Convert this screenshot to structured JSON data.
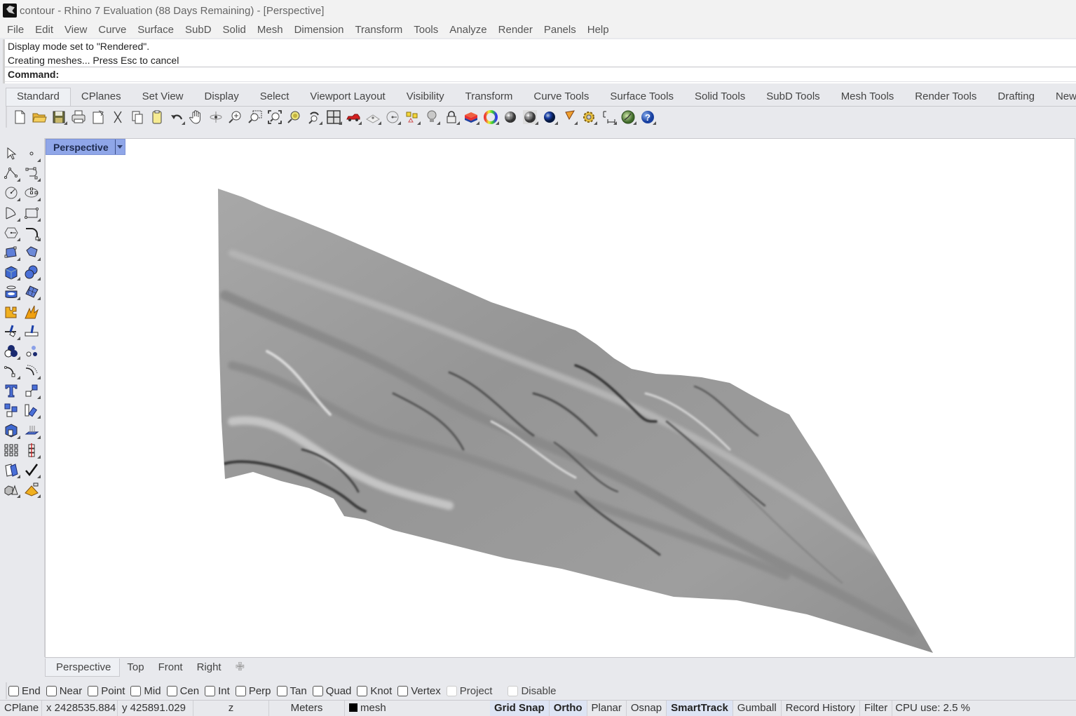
{
  "window": {
    "title": "contour - Rhino 7 Evaluation (88 Days Remaining) - [Perspective]",
    "app_icon": "rhino-icon"
  },
  "menubar": {
    "items": [
      "File",
      "Edit",
      "View",
      "Curve",
      "Surface",
      "SubD",
      "Solid",
      "Mesh",
      "Dimension",
      "Transform",
      "Tools",
      "Analyze",
      "Render",
      "Panels",
      "Help"
    ]
  },
  "command_history": {
    "lines": [
      "Display mode set to \"Rendered\".",
      "Creating meshes... Press Esc to cancel"
    ],
    "prompt_label": "Command:",
    "input_value": ""
  },
  "toolbar_tabs": {
    "active": "Standard",
    "items": [
      "Standard",
      "CPlanes",
      "Set View",
      "Display",
      "Select",
      "Viewport Layout",
      "Visibility",
      "Transform",
      "Curve Tools",
      "Surface Tools",
      "Solid Tools",
      "SubD Tools",
      "Mesh Tools",
      "Render Tools",
      "Drafting",
      "New in"
    ]
  },
  "standard_toolbar": {
    "icons": [
      "new-file-icon",
      "open-folder-icon",
      "save-icon",
      "print-icon",
      "import-icon",
      "cut-icon",
      "copy-icon",
      "paste-icon",
      "undo-icon",
      "pan-hand-icon",
      "rotate-view-icon",
      "zoom-dynamic-icon",
      "zoom-window-icon",
      "zoom-extents-icon",
      "zoom-selected-icon",
      "undo-view-icon",
      "four-viewports-icon",
      "car-named-views-icon",
      "cplane-icon",
      "circle-tool-icon",
      "select-points-icon",
      "light-bulb-icon",
      "lock-icon",
      "layer-icon",
      "color-wheel-icon",
      "shaded-sphere-icon",
      "rendered-sphere-icon",
      "material-sphere-icon",
      "render-cone-icon",
      "options-gear-icon",
      "dimension-icon",
      "globe-icon",
      "help-icon"
    ]
  },
  "sidebar": {
    "icons": [
      "select-arrow-icon",
      "point-icon",
      "polyline-icon",
      "curve-control-points-icon",
      "circle-icon",
      "ellipse-icon",
      "arc-icon",
      "rectangle-icon",
      "polygon-icon",
      "fillet-curve-icon",
      "surface-from-points-icon",
      "extrude-surface-icon",
      "box-solid-icon",
      "boolean-union-icon",
      "cylinder-icon",
      "mesh-surface-icon",
      "puzzle-icon",
      "explode-icon",
      "trim-icon",
      "split-icon",
      "boolean-icon",
      "group-icon",
      "curve-end-icon",
      "offset-curve-icon",
      "text-icon",
      "scale-icon",
      "array-icon",
      "align-icon",
      "block-icon",
      "contour-icon",
      "grid-array-icon",
      "section-icon",
      "analyze-icon",
      "check-icon",
      "solid-primitives-icon",
      "render-pyramid-icon"
    ]
  },
  "viewport": {
    "name": "Perspective",
    "display_mode": "Rendered",
    "background": "#ffffff",
    "mesh_color": "#9a9a9a"
  },
  "viewport_tabs": {
    "active": "Perspective",
    "items": [
      "Perspective",
      "Top",
      "Front",
      "Right"
    ],
    "add_icon": "plus-icon"
  },
  "osnaps": [
    {
      "label": "End",
      "checked": false,
      "enabled": true
    },
    {
      "label": "Near",
      "checked": false,
      "enabled": true
    },
    {
      "label": "Point",
      "checked": false,
      "enabled": true
    },
    {
      "label": "Mid",
      "checked": false,
      "enabled": true
    },
    {
      "label": "Cen",
      "checked": false,
      "enabled": true
    },
    {
      "label": "Int",
      "checked": false,
      "enabled": true
    },
    {
      "label": "Perp",
      "checked": false,
      "enabled": true
    },
    {
      "label": "Tan",
      "checked": false,
      "enabled": true
    },
    {
      "label": "Quad",
      "checked": false,
      "enabled": true
    },
    {
      "label": "Knot",
      "checked": false,
      "enabled": true
    },
    {
      "label": "Vertex",
      "checked": false,
      "enabled": true
    },
    {
      "label": "Project",
      "checked": false,
      "enabled": false
    },
    {
      "label": "Disable",
      "checked": false,
      "enabled": false
    }
  ],
  "statusbar": {
    "cplane": "CPlane",
    "x": "x 2428535.884",
    "y": "y 425891.029",
    "z": "z",
    "units": "Meters",
    "layer": "mesh",
    "layer_color": "#000000",
    "toggles": [
      {
        "label": "Grid Snap",
        "on": true
      },
      {
        "label": "Ortho",
        "on": true
      },
      {
        "label": "Planar",
        "on": false
      },
      {
        "label": "Osnap",
        "on": false
      },
      {
        "label": "SmartTrack",
        "on": true
      },
      {
        "label": "Gumball",
        "on": false
      },
      {
        "label": "Record History",
        "on": false
      },
      {
        "label": "Filter",
        "on": false
      }
    ],
    "cpu": "CPU use: 2.5 %"
  }
}
